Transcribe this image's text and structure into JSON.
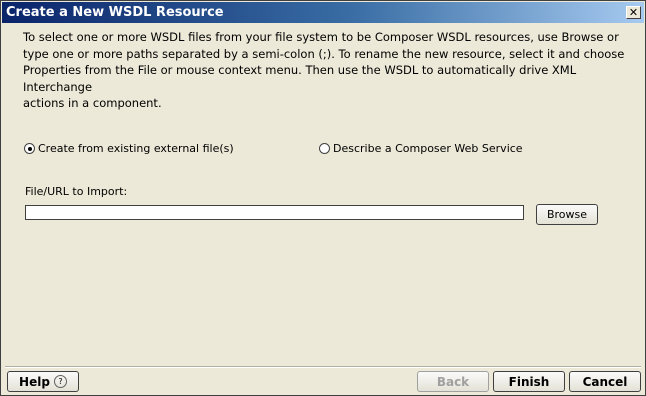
{
  "window": {
    "title": "Create a New WSDL Resource",
    "close_glyph": "✕"
  },
  "description": "To select one or more WSDL files from your file system to be Composer WSDL  resources, use Browse or\ntype one or more paths separated by a semi-colon (;).  To rename the new resource, select it and choose\nProperties from the File or mouse context menu. Then use the WSDL to automatically drive XML Interchange\nactions in a component.",
  "options": {
    "existing_file_label": "Create from existing external file(s)",
    "existing_file_selected": true,
    "describe_service_label": "Describe a Composer Web Service",
    "describe_service_selected": false
  },
  "file": {
    "label": "File/URL to Import:",
    "value": "",
    "browse_label": "Browse"
  },
  "footer": {
    "help_label": "Help",
    "help_icon": "?",
    "back_label": "Back",
    "back_enabled": false,
    "finish_label": "Finish",
    "cancel_label": "Cancel"
  },
  "colors": {
    "title_gradient_start": "#0a246a",
    "title_gradient_end": "#a6caf0",
    "dialog_background": "#ece9d8"
  }
}
